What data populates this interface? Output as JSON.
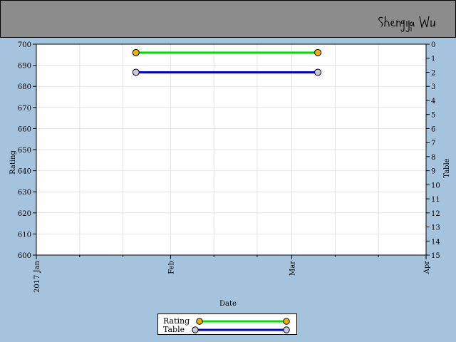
{
  "chart_data": {
    "type": "line",
    "x_axis": {
      "label": "Date",
      "ticks": [
        {
          "label": "2017 Jan",
          "date": "2017-01-01"
        },
        {
          "label": "Feb",
          "date": "2017-02-01"
        },
        {
          "label": "Mar",
          "date": "2017-03-01"
        },
        {
          "label": "Apr",
          "date": "2017-04-01"
        }
      ],
      "range": [
        "2017-01-01",
        "2017-04-01"
      ]
    },
    "y_left": {
      "label": "Rating",
      "ylim": [
        600,
        700
      ],
      "ticks": [
        600,
        610,
        620,
        630,
        640,
        650,
        660,
        670,
        680,
        690,
        700
      ]
    },
    "y_right": {
      "label": "Table",
      "ylim": [
        0,
        15
      ],
      "ticks": [
        0,
        1,
        2,
        3,
        4,
        5,
        6,
        7,
        8,
        9,
        10,
        11,
        12,
        13,
        14,
        15
      ],
      "inverted": true
    },
    "series": [
      {
        "name": "Rating",
        "axis": "left",
        "color": "#00e000",
        "marker_color": "#f0b000",
        "points": [
          {
            "x": "2017-01-24",
            "y": 696
          },
          {
            "x": "2017-03-07",
            "y": 696
          }
        ]
      },
      {
        "name": "Table",
        "axis": "right",
        "color": "#0000d0",
        "marker_color": "#c8c8dc",
        "points": [
          {
            "x": "2017-01-24",
            "y": 2
          },
          {
            "x": "2017-03-07",
            "y": 2
          }
        ]
      }
    ],
    "grid": true,
    "legend_position": "bottom-center"
  },
  "header": {
    "signature": "Shengjia Wu"
  }
}
